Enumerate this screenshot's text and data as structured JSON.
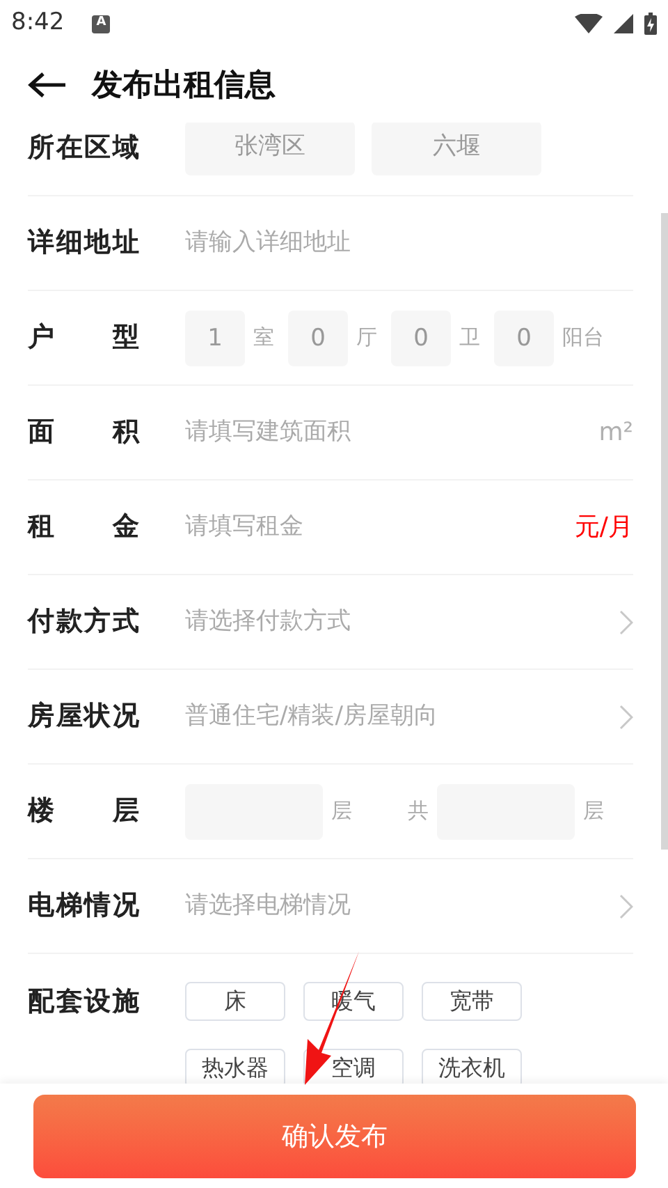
{
  "status_bar": {
    "time": "8:42",
    "notification": "A"
  },
  "header": {
    "title": "发布出租信息"
  },
  "rows": [
    {
      "kind": "chips",
      "label": "所在区域",
      "chips": [
        "张湾区",
        "六堰"
      ]
    },
    {
      "kind": "input",
      "label": "详细地址",
      "placeholder": "请输入详细地址"
    },
    {
      "kind": "counts",
      "label": "户型",
      "counts": [
        {
          "value": "1",
          "unit": "室"
        },
        {
          "value": "0",
          "unit": "厅"
        },
        {
          "value": "0",
          "unit": "卫"
        },
        {
          "value": "0",
          "unit": "阳台"
        }
      ]
    },
    {
      "kind": "input",
      "label": "面积",
      "placeholder": "请填写建筑面积",
      "unit": "m²",
      "accent": false
    },
    {
      "kind": "input",
      "label": "租金",
      "placeholder": "请填写租金",
      "unit": "元/月",
      "accent": true
    },
    {
      "kind": "select",
      "label": "付款方式",
      "placeholder": "请选择付款方式"
    },
    {
      "kind": "select",
      "label": "房屋状况",
      "placeholder": "普通住宅/精装/房屋朝向"
    },
    {
      "kind": "floor",
      "label": "楼层",
      "unit": "层",
      "total_label": "共",
      "total_unit": "层"
    },
    {
      "kind": "select",
      "label": "电梯情况",
      "placeholder": "请选择电梯情况"
    },
    {
      "kind": "tags",
      "label": "配套设施",
      "tags": [
        "床",
        "暖气",
        "宽带",
        "热水器",
        "空调",
        "洗衣机"
      ]
    }
  ],
  "submit": {
    "label": "确认发布"
  }
}
